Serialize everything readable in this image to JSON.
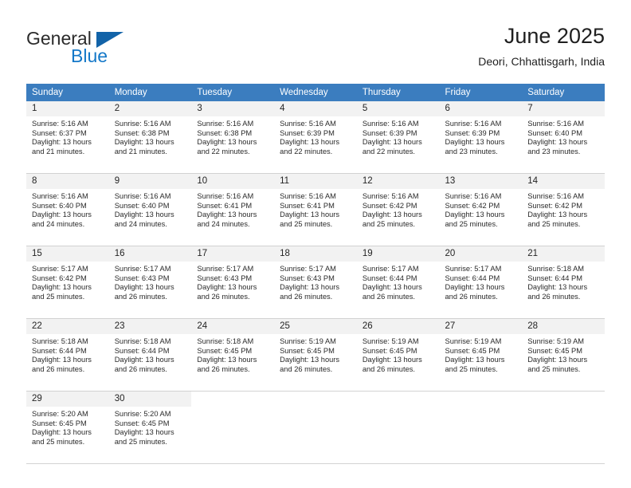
{
  "brand": {
    "word1": "General",
    "word2": "Blue",
    "triangle_color": "#1263a8",
    "blue_color": "#1478c8"
  },
  "header": {
    "title": "June 2025",
    "subtitle": "Deori, Chhattisgarh, India"
  },
  "theme": {
    "header_row_bg": "#3b7dbf",
    "daynum_bg": "#f2f2f2",
    "grid_line": "#d2d2d2"
  },
  "weekday_headers": [
    "Sunday",
    "Monday",
    "Tuesday",
    "Wednesday",
    "Thursday",
    "Friday",
    "Saturday"
  ],
  "weeks": [
    [
      {
        "day": "1",
        "sunrise": "Sunrise: 5:16 AM",
        "sunset": "Sunset: 6:37 PM",
        "daylight1": "Daylight: 13 hours",
        "daylight2": "and 21 minutes."
      },
      {
        "day": "2",
        "sunrise": "Sunrise: 5:16 AM",
        "sunset": "Sunset: 6:38 PM",
        "daylight1": "Daylight: 13 hours",
        "daylight2": "and 21 minutes."
      },
      {
        "day": "3",
        "sunrise": "Sunrise: 5:16 AM",
        "sunset": "Sunset: 6:38 PM",
        "daylight1": "Daylight: 13 hours",
        "daylight2": "and 22 minutes."
      },
      {
        "day": "4",
        "sunrise": "Sunrise: 5:16 AM",
        "sunset": "Sunset: 6:39 PM",
        "daylight1": "Daylight: 13 hours",
        "daylight2": "and 22 minutes."
      },
      {
        "day": "5",
        "sunrise": "Sunrise: 5:16 AM",
        "sunset": "Sunset: 6:39 PM",
        "daylight1": "Daylight: 13 hours",
        "daylight2": "and 22 minutes."
      },
      {
        "day": "6",
        "sunrise": "Sunrise: 5:16 AM",
        "sunset": "Sunset: 6:39 PM",
        "daylight1": "Daylight: 13 hours",
        "daylight2": "and 23 minutes."
      },
      {
        "day": "7",
        "sunrise": "Sunrise: 5:16 AM",
        "sunset": "Sunset: 6:40 PM",
        "daylight1": "Daylight: 13 hours",
        "daylight2": "and 23 minutes."
      }
    ],
    [
      {
        "day": "8",
        "sunrise": "Sunrise: 5:16 AM",
        "sunset": "Sunset: 6:40 PM",
        "daylight1": "Daylight: 13 hours",
        "daylight2": "and 24 minutes."
      },
      {
        "day": "9",
        "sunrise": "Sunrise: 5:16 AM",
        "sunset": "Sunset: 6:40 PM",
        "daylight1": "Daylight: 13 hours",
        "daylight2": "and 24 minutes."
      },
      {
        "day": "10",
        "sunrise": "Sunrise: 5:16 AM",
        "sunset": "Sunset: 6:41 PM",
        "daylight1": "Daylight: 13 hours",
        "daylight2": "and 24 minutes."
      },
      {
        "day": "11",
        "sunrise": "Sunrise: 5:16 AM",
        "sunset": "Sunset: 6:41 PM",
        "daylight1": "Daylight: 13 hours",
        "daylight2": "and 25 minutes."
      },
      {
        "day": "12",
        "sunrise": "Sunrise: 5:16 AM",
        "sunset": "Sunset: 6:42 PM",
        "daylight1": "Daylight: 13 hours",
        "daylight2": "and 25 minutes."
      },
      {
        "day": "13",
        "sunrise": "Sunrise: 5:16 AM",
        "sunset": "Sunset: 6:42 PM",
        "daylight1": "Daylight: 13 hours",
        "daylight2": "and 25 minutes."
      },
      {
        "day": "14",
        "sunrise": "Sunrise: 5:16 AM",
        "sunset": "Sunset: 6:42 PM",
        "daylight1": "Daylight: 13 hours",
        "daylight2": "and 25 minutes."
      }
    ],
    [
      {
        "day": "15",
        "sunrise": "Sunrise: 5:17 AM",
        "sunset": "Sunset: 6:42 PM",
        "daylight1": "Daylight: 13 hours",
        "daylight2": "and 25 minutes."
      },
      {
        "day": "16",
        "sunrise": "Sunrise: 5:17 AM",
        "sunset": "Sunset: 6:43 PM",
        "daylight1": "Daylight: 13 hours",
        "daylight2": "and 26 minutes."
      },
      {
        "day": "17",
        "sunrise": "Sunrise: 5:17 AM",
        "sunset": "Sunset: 6:43 PM",
        "daylight1": "Daylight: 13 hours",
        "daylight2": "and 26 minutes."
      },
      {
        "day": "18",
        "sunrise": "Sunrise: 5:17 AM",
        "sunset": "Sunset: 6:43 PM",
        "daylight1": "Daylight: 13 hours",
        "daylight2": "and 26 minutes."
      },
      {
        "day": "19",
        "sunrise": "Sunrise: 5:17 AM",
        "sunset": "Sunset: 6:44 PM",
        "daylight1": "Daylight: 13 hours",
        "daylight2": "and 26 minutes."
      },
      {
        "day": "20",
        "sunrise": "Sunrise: 5:17 AM",
        "sunset": "Sunset: 6:44 PM",
        "daylight1": "Daylight: 13 hours",
        "daylight2": "and 26 minutes."
      },
      {
        "day": "21",
        "sunrise": "Sunrise: 5:18 AM",
        "sunset": "Sunset: 6:44 PM",
        "daylight1": "Daylight: 13 hours",
        "daylight2": "and 26 minutes."
      }
    ],
    [
      {
        "day": "22",
        "sunrise": "Sunrise: 5:18 AM",
        "sunset": "Sunset: 6:44 PM",
        "daylight1": "Daylight: 13 hours",
        "daylight2": "and 26 minutes."
      },
      {
        "day": "23",
        "sunrise": "Sunrise: 5:18 AM",
        "sunset": "Sunset: 6:44 PM",
        "daylight1": "Daylight: 13 hours",
        "daylight2": "and 26 minutes."
      },
      {
        "day": "24",
        "sunrise": "Sunrise: 5:18 AM",
        "sunset": "Sunset: 6:45 PM",
        "daylight1": "Daylight: 13 hours",
        "daylight2": "and 26 minutes."
      },
      {
        "day": "25",
        "sunrise": "Sunrise: 5:19 AM",
        "sunset": "Sunset: 6:45 PM",
        "daylight1": "Daylight: 13 hours",
        "daylight2": "and 26 minutes."
      },
      {
        "day": "26",
        "sunrise": "Sunrise: 5:19 AM",
        "sunset": "Sunset: 6:45 PM",
        "daylight1": "Daylight: 13 hours",
        "daylight2": "and 26 minutes."
      },
      {
        "day": "27",
        "sunrise": "Sunrise: 5:19 AM",
        "sunset": "Sunset: 6:45 PM",
        "daylight1": "Daylight: 13 hours",
        "daylight2": "and 25 minutes."
      },
      {
        "day": "28",
        "sunrise": "Sunrise: 5:19 AM",
        "sunset": "Sunset: 6:45 PM",
        "daylight1": "Daylight: 13 hours",
        "daylight2": "and 25 minutes."
      }
    ],
    [
      {
        "day": "29",
        "sunrise": "Sunrise: 5:20 AM",
        "sunset": "Sunset: 6:45 PM",
        "daylight1": "Daylight: 13 hours",
        "daylight2": "and 25 minutes."
      },
      {
        "day": "30",
        "sunrise": "Sunrise: 5:20 AM",
        "sunset": "Sunset: 6:45 PM",
        "daylight1": "Daylight: 13 hours",
        "daylight2": "and 25 minutes."
      },
      null,
      null,
      null,
      null,
      null
    ]
  ]
}
